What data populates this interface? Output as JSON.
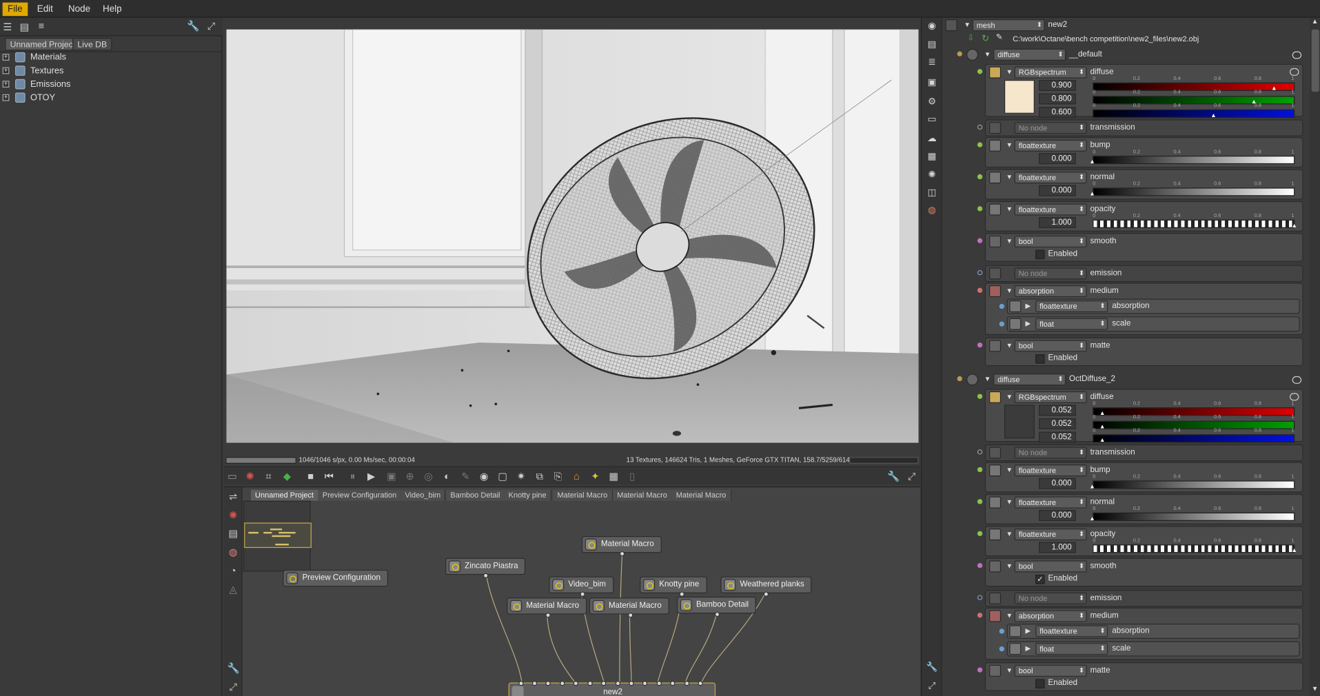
{
  "menu": {
    "file": "File",
    "edit": "Edit",
    "node": "Node",
    "help": "Help"
  },
  "left": {
    "tabs": [
      "Unnamed Project",
      "Live DB"
    ],
    "tree": [
      "Materials",
      "Textures",
      "Emissions",
      "OTOY"
    ]
  },
  "viewport": {
    "status_left": "1046/1046 s/px, 0.00 Ms/sec, 00:00:04",
    "status_right": "13 Textures, 146624 Tris, 1 Meshes, GeForce GTX TITAN, 158.7/5259/6144 MB"
  },
  "graph": {
    "tabs": [
      "Unnamed Project",
      "Preview Configuration",
      "Video_bim",
      "Bamboo Detail",
      "Knotty pine",
      "Material Macro",
      "Material Macro",
      "Material Macro"
    ],
    "nodes": {
      "preview": "Preview Configuration",
      "mm_top": "Material Macro",
      "zincato": "Zincato Piastra",
      "video": "Video_bim",
      "knotty": "Knotty pine",
      "weathered": "Weathered planks",
      "mm_left": "Material Macro",
      "mm_mid": "Material Macro",
      "bamboo": "Bamboo Detail",
      "output": "new2"
    }
  },
  "inspector": {
    "mesh_type": "mesh",
    "mesh_name": "new2",
    "path": "C:\\work\\Octane\\bench competition\\new2_files\\new2.obj",
    "materials": [
      {
        "type": "diffuse",
        "name": "__default",
        "diffuse": {
          "type": "RGBspectrum",
          "label": "diffuse",
          "color": "#f5e6cc",
          "r": "0.900",
          "g": "0.800",
          "b": "0.600",
          "r_frac": 0.9,
          "g_frac": 0.8,
          "b_frac": 0.6
        },
        "transmission": {
          "type": "No node",
          "label": "transmission"
        },
        "bump": {
          "type": "floattexture",
          "label": "bump",
          "value": "0.000"
        },
        "normal": {
          "type": "floattexture",
          "label": "normal",
          "value": "0.000"
        },
        "opacity": {
          "type": "floattexture",
          "label": "opacity",
          "value": "1.000"
        },
        "smooth": {
          "type": "bool",
          "label": "smooth",
          "check": "Enabled",
          "checked": false
        },
        "emission": {
          "type": "No node",
          "label": "emission"
        },
        "medium": {
          "type": "absorption",
          "label": "medium",
          "sub1_type": "floattexture",
          "sub1_label": "absorption",
          "sub2_type": "float",
          "sub2_label": "scale"
        },
        "matte": {
          "type": "bool",
          "label": "matte",
          "check": "Enabled",
          "checked": false
        }
      },
      {
        "type": "diffuse",
        "name": "OctDiffuse_2",
        "diffuse": {
          "type": "RGBspectrum",
          "label": "diffuse",
          "color": "#3b3b3b",
          "r": "0.052",
          "g": "0.052",
          "b": "0.052",
          "r_frac": 0.052,
          "g_frac": 0.052,
          "b_frac": 0.052
        },
        "transmission": {
          "type": "No node",
          "label": "transmission"
        },
        "bump": {
          "type": "floattexture",
          "label": "bump",
          "value": "0.000"
        },
        "normal": {
          "type": "floattexture",
          "label": "normal",
          "value": "0.000"
        },
        "opacity": {
          "type": "floattexture",
          "label": "opacity",
          "value": "1.000"
        },
        "smooth": {
          "type": "bool",
          "label": "smooth",
          "check": "Enabled",
          "checked": true
        },
        "emission": {
          "type": "No node",
          "label": "emission"
        },
        "medium": {
          "type": "absorption",
          "label": "medium",
          "sub1_type": "floattexture",
          "sub1_label": "absorption",
          "sub2_type": "float",
          "sub2_label": "scale"
        },
        "matte": {
          "type": "bool",
          "label": "matte",
          "check": "Enabled",
          "checked": false
        }
      }
    ],
    "ticks": [
      "0",
      "0.2",
      "0.4",
      "0.6",
      "0.8",
      "1"
    ]
  }
}
